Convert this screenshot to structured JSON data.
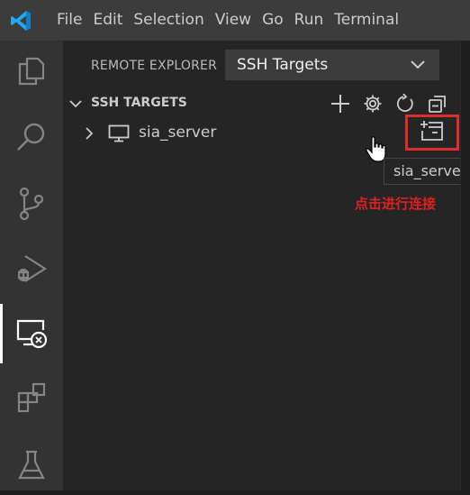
{
  "menubar": {
    "items": [
      "File",
      "Edit",
      "Selection",
      "View",
      "Go",
      "Run",
      "Terminal"
    ]
  },
  "activitybar": {
    "icons": [
      "files-icon",
      "search-icon",
      "source-control-icon",
      "run-debug-icon",
      "remote-explorer-icon",
      "extensions-icon",
      "testing-icon"
    ],
    "active": "remote-explorer-icon"
  },
  "sidebar": {
    "header_title": "REMOTE EXPLORER",
    "target_select_value": "SSH Targets",
    "section_title": "SSH TARGETS",
    "tools": [
      "add-icon",
      "gear-icon",
      "refresh-icon",
      "collapse-all-icon"
    ],
    "tree": [
      {
        "label": "sia_server",
        "icon": "monitor-icon",
        "action_icon": "connect-in-new-window-icon"
      }
    ],
    "tooltip": "sia_server"
  },
  "annotation": "点击进行连接",
  "colors": {
    "menubar_bg": "#3c3c3c",
    "activitybar_bg": "#333333",
    "sidebar_bg": "#252526",
    "highlight": "#e22b2b",
    "annotation": "#e02020",
    "logo": "#23a9f2"
  }
}
